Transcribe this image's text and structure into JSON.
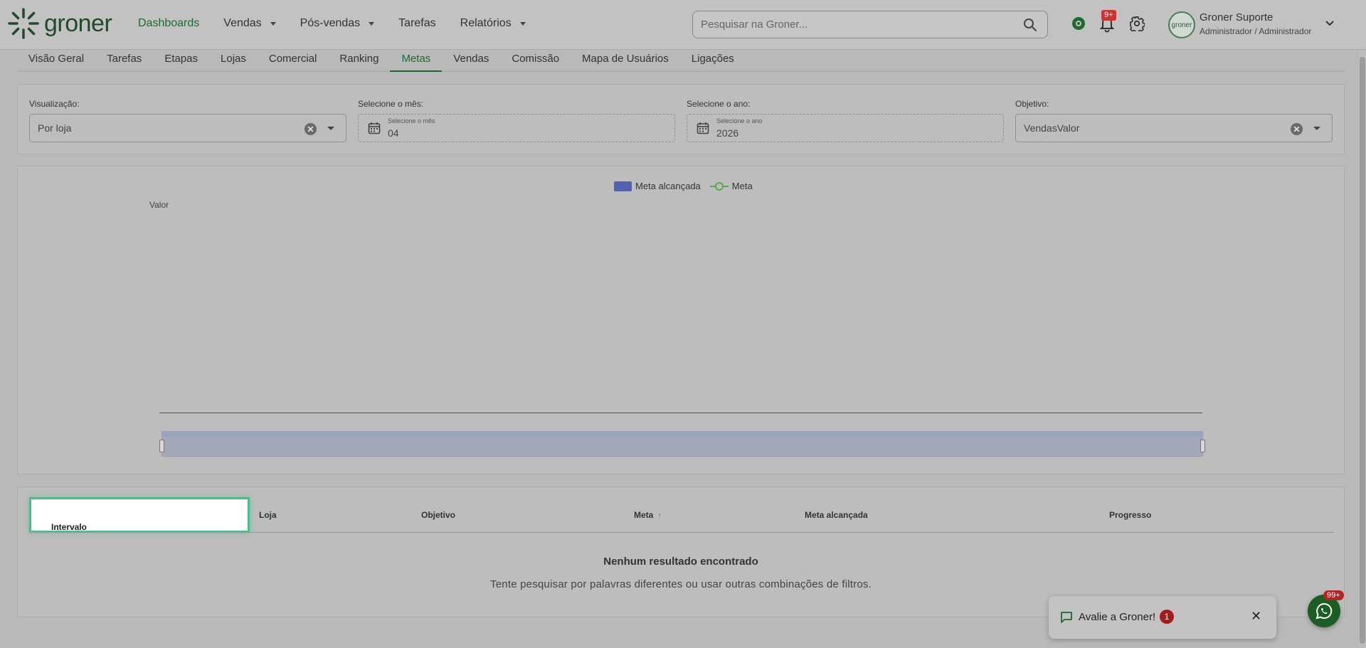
{
  "header": {
    "logo_text": "groner",
    "nav": [
      {
        "label": "Dashboards",
        "has_caret": false
      },
      {
        "label": "Vendas",
        "has_caret": true
      },
      {
        "label": "Pós-vendas",
        "has_caret": true
      },
      {
        "label": "Tarefas",
        "has_caret": false
      },
      {
        "label": "Relatórios",
        "has_caret": true
      }
    ],
    "search_placeholder": "Pesquisar na Groner...",
    "notifications_badge": "9+",
    "user_name": "Groner Suporte",
    "user_role": "Administrador / Administrador",
    "avatar_text": "groner"
  },
  "tabs": [
    "Visão Geral",
    "Tarefas",
    "Etapas",
    "Lojas",
    "Comercial",
    "Ranking",
    "Metas",
    "Vendas",
    "Comissão",
    "Mapa de Usuários",
    "Ligações"
  ],
  "active_tab": "Metas",
  "filters": {
    "visualizacao": {
      "label": "Visualização:",
      "value": "Por loja"
    },
    "mes": {
      "label": "Selecione o mês:",
      "small_label": "Selecione o mês",
      "value": "04"
    },
    "ano": {
      "label": "Selecione o ano:",
      "small_label": "Selecione o ano",
      "value": "2026"
    },
    "objetivo": {
      "label": "Objetivo:",
      "value": "VendasValor"
    }
  },
  "chart_data": {
    "type": "bar",
    "categories": [],
    "series": [
      {
        "name": "Meta alcançada",
        "values": []
      },
      {
        "name": "Meta",
        "values": []
      }
    ],
    "ylabel": "Valor",
    "colors": {
      "Meta alcançada": "#4f63b0",
      "Meta": "#5da64a"
    }
  },
  "table": {
    "columns": [
      "Intervalo",
      "Loja",
      "Objetivo",
      "Meta",
      "Meta alcançada",
      "Progresso"
    ],
    "empty_title": "Nenhum resultado encontrado",
    "empty_subtitle": "Tente pesquisar por palavras diferentes ou usar outras combinações de filtros."
  },
  "feedback": {
    "text": "Avalie a Groner!",
    "count": "1"
  },
  "whatsapp_badge": "99+"
}
